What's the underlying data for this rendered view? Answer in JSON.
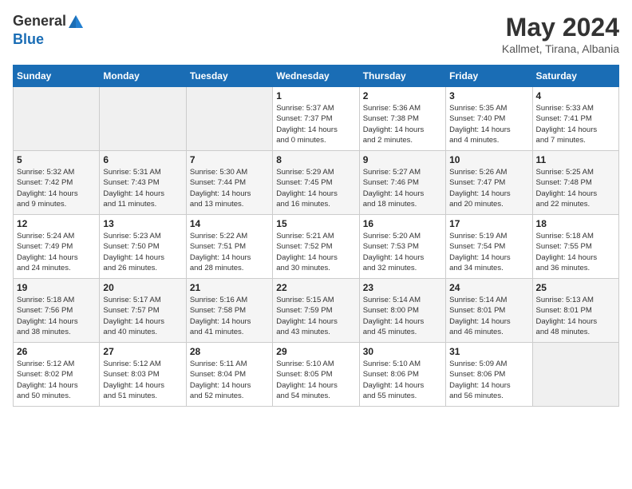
{
  "header": {
    "logo_general": "General",
    "logo_blue": "Blue",
    "title": "May 2024",
    "subtitle": "Kallmet, Tirana, Albania"
  },
  "weekdays": [
    "Sunday",
    "Monday",
    "Tuesday",
    "Wednesday",
    "Thursday",
    "Friday",
    "Saturday"
  ],
  "weeks": [
    [
      {
        "day": "",
        "info": ""
      },
      {
        "day": "",
        "info": ""
      },
      {
        "day": "",
        "info": ""
      },
      {
        "day": "1",
        "info": "Sunrise: 5:37 AM\nSunset: 7:37 PM\nDaylight: 14 hours\nand 0 minutes."
      },
      {
        "day": "2",
        "info": "Sunrise: 5:36 AM\nSunset: 7:38 PM\nDaylight: 14 hours\nand 2 minutes."
      },
      {
        "day": "3",
        "info": "Sunrise: 5:35 AM\nSunset: 7:40 PM\nDaylight: 14 hours\nand 4 minutes."
      },
      {
        "day": "4",
        "info": "Sunrise: 5:33 AM\nSunset: 7:41 PM\nDaylight: 14 hours\nand 7 minutes."
      }
    ],
    [
      {
        "day": "5",
        "info": "Sunrise: 5:32 AM\nSunset: 7:42 PM\nDaylight: 14 hours\nand 9 minutes."
      },
      {
        "day": "6",
        "info": "Sunrise: 5:31 AM\nSunset: 7:43 PM\nDaylight: 14 hours\nand 11 minutes."
      },
      {
        "day": "7",
        "info": "Sunrise: 5:30 AM\nSunset: 7:44 PM\nDaylight: 14 hours\nand 13 minutes."
      },
      {
        "day": "8",
        "info": "Sunrise: 5:29 AM\nSunset: 7:45 PM\nDaylight: 14 hours\nand 16 minutes."
      },
      {
        "day": "9",
        "info": "Sunrise: 5:27 AM\nSunset: 7:46 PM\nDaylight: 14 hours\nand 18 minutes."
      },
      {
        "day": "10",
        "info": "Sunrise: 5:26 AM\nSunset: 7:47 PM\nDaylight: 14 hours\nand 20 minutes."
      },
      {
        "day": "11",
        "info": "Sunrise: 5:25 AM\nSunset: 7:48 PM\nDaylight: 14 hours\nand 22 minutes."
      }
    ],
    [
      {
        "day": "12",
        "info": "Sunrise: 5:24 AM\nSunset: 7:49 PM\nDaylight: 14 hours\nand 24 minutes."
      },
      {
        "day": "13",
        "info": "Sunrise: 5:23 AM\nSunset: 7:50 PM\nDaylight: 14 hours\nand 26 minutes."
      },
      {
        "day": "14",
        "info": "Sunrise: 5:22 AM\nSunset: 7:51 PM\nDaylight: 14 hours\nand 28 minutes."
      },
      {
        "day": "15",
        "info": "Sunrise: 5:21 AM\nSunset: 7:52 PM\nDaylight: 14 hours\nand 30 minutes."
      },
      {
        "day": "16",
        "info": "Sunrise: 5:20 AM\nSunset: 7:53 PM\nDaylight: 14 hours\nand 32 minutes."
      },
      {
        "day": "17",
        "info": "Sunrise: 5:19 AM\nSunset: 7:54 PM\nDaylight: 14 hours\nand 34 minutes."
      },
      {
        "day": "18",
        "info": "Sunrise: 5:18 AM\nSunset: 7:55 PM\nDaylight: 14 hours\nand 36 minutes."
      }
    ],
    [
      {
        "day": "19",
        "info": "Sunrise: 5:18 AM\nSunset: 7:56 PM\nDaylight: 14 hours\nand 38 minutes."
      },
      {
        "day": "20",
        "info": "Sunrise: 5:17 AM\nSunset: 7:57 PM\nDaylight: 14 hours\nand 40 minutes."
      },
      {
        "day": "21",
        "info": "Sunrise: 5:16 AM\nSunset: 7:58 PM\nDaylight: 14 hours\nand 41 minutes."
      },
      {
        "day": "22",
        "info": "Sunrise: 5:15 AM\nSunset: 7:59 PM\nDaylight: 14 hours\nand 43 minutes."
      },
      {
        "day": "23",
        "info": "Sunrise: 5:14 AM\nSunset: 8:00 PM\nDaylight: 14 hours\nand 45 minutes."
      },
      {
        "day": "24",
        "info": "Sunrise: 5:14 AM\nSunset: 8:01 PM\nDaylight: 14 hours\nand 46 minutes."
      },
      {
        "day": "25",
        "info": "Sunrise: 5:13 AM\nSunset: 8:01 PM\nDaylight: 14 hours\nand 48 minutes."
      }
    ],
    [
      {
        "day": "26",
        "info": "Sunrise: 5:12 AM\nSunset: 8:02 PM\nDaylight: 14 hours\nand 50 minutes."
      },
      {
        "day": "27",
        "info": "Sunrise: 5:12 AM\nSunset: 8:03 PM\nDaylight: 14 hours\nand 51 minutes."
      },
      {
        "day": "28",
        "info": "Sunrise: 5:11 AM\nSunset: 8:04 PM\nDaylight: 14 hours\nand 52 minutes."
      },
      {
        "day": "29",
        "info": "Sunrise: 5:10 AM\nSunset: 8:05 PM\nDaylight: 14 hours\nand 54 minutes."
      },
      {
        "day": "30",
        "info": "Sunrise: 5:10 AM\nSunset: 8:06 PM\nDaylight: 14 hours\nand 55 minutes."
      },
      {
        "day": "31",
        "info": "Sunrise: 5:09 AM\nSunset: 8:06 PM\nDaylight: 14 hours\nand 56 minutes."
      },
      {
        "day": "",
        "info": ""
      }
    ]
  ]
}
